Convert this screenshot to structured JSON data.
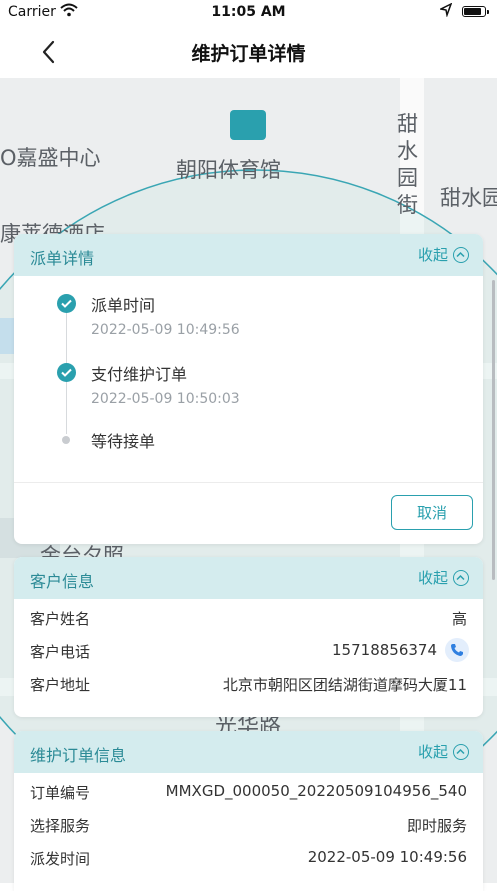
{
  "status_bar": {
    "carrier": "Carrier",
    "time": "11:05 AM",
    "battery_level": 0.9
  },
  "nav": {
    "title": "维护订单详情"
  },
  "map": {
    "labels": [
      "O嘉盛中心",
      "朝阳体育馆",
      "甜",
      "水",
      "园",
      "街",
      "甜水园",
      "康莱德酒店",
      "光华路",
      "金台夕照"
    ]
  },
  "dispatch": {
    "title": "派单详情",
    "collapse_label": "收起",
    "steps": [
      {
        "label": "派单时间",
        "time": "2022-05-09 10:49:56",
        "done": true
      },
      {
        "label": "支付维护订单",
        "time": "2022-05-09 10:50:03",
        "done": true
      },
      {
        "label": "等待接单",
        "time": "",
        "done": false
      }
    ],
    "cancel_label": "取消"
  },
  "customer": {
    "title": "客户信息",
    "collapse_label": "收起",
    "name_key": "客户姓名",
    "name_value": "高",
    "phone_key": "客户电话",
    "phone_value": "15718856374",
    "address_key": "客户地址",
    "address_value": "北京市朝阳区团结湖街道摩码大厦11"
  },
  "order": {
    "title": "维护订单信息",
    "collapse_label": "收起",
    "no_key": "订单编号",
    "no_value": "MMXGD_000050_20220509104956_540",
    "service_key": "选择服务",
    "service_value": "即时服务",
    "dispatch_time_key": "派发时间",
    "dispatch_time_value": "2022-05-09 10:49:56"
  },
  "colors": {
    "accent": "#2aa0ae",
    "header_bg": "#d4ecee",
    "map_bg": "#eceeef"
  }
}
